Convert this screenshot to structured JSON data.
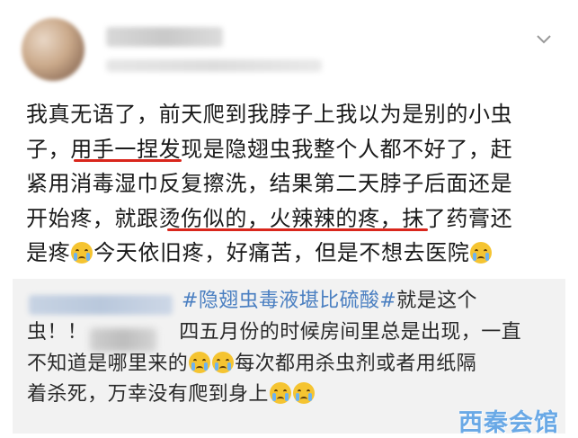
{
  "post": {
    "lines": [
      "我真无语了，前天爬到我脖子上我以为是别的小虫",
      "子，用手一捏发现是隐翅虫我整个人都不好了，赶",
      "紧用消毒湿巾反复擦洗，结果第二天脖子后面还是",
      "开始疼，就跟烫伤似的，火辣辣的疼，抹了药膏还",
      "是疼"
    ],
    "line5_rest": "今天依旧疼，好痛苦，但是不想去医院",
    "emoji": "crying-face"
  },
  "repost": {
    "hashtag": "#隐翅虫毒液堪比硫酸#",
    "line1_rest": "就是这个",
    "line2_start": "虫！！",
    "line2_rest": "四五月份的时候房间里总是出现，一直",
    "line3": "不知道是哪里来的",
    "line3_rest": "每次都用杀虫剂或者用纸隔",
    "line4": "着杀死，万幸没有爬到身上"
  },
  "watermark": "西秦会馆",
  "colors": {
    "underline": "#d9261c",
    "hashtag": "#4a7fc1",
    "repost_bg": "#f2f2f2"
  }
}
